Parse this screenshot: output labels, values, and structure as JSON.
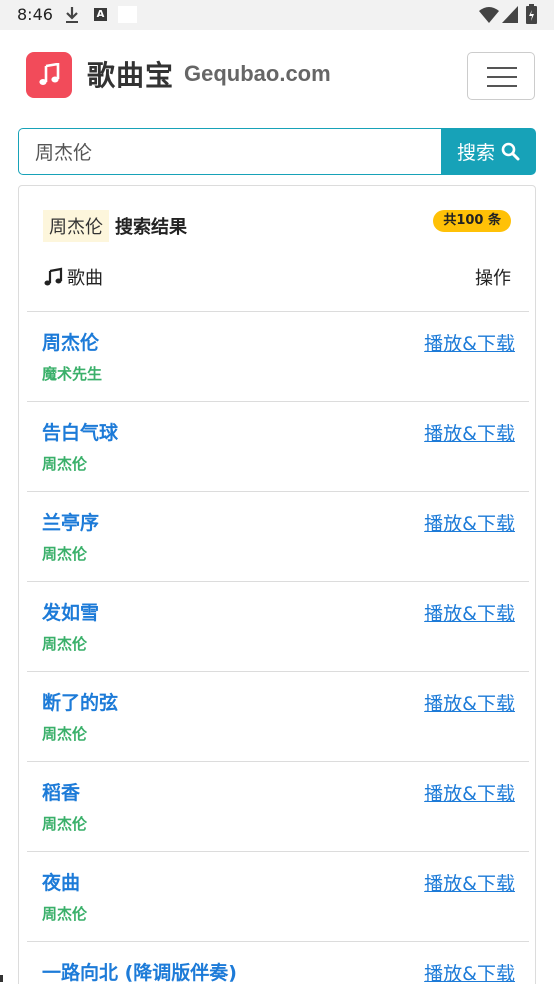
{
  "status_bar": {
    "time": "8:46",
    "icons": [
      "download-icon",
      "a-letter-icon",
      "white-box-icon",
      "wifi-icon",
      "signal-icon",
      "battery-icon"
    ],
    "a_letter": "A"
  },
  "navbar": {
    "brand_cn": "歌曲宝",
    "brand_en": "Gequbao.com",
    "logo_color": "#f24b5a",
    "menu_icon": "hamburger-icon"
  },
  "search": {
    "value": "周杰伦",
    "button_label": "搜索",
    "accent": "#17a2b8"
  },
  "results": {
    "query": "周杰伦",
    "label": "搜索结果",
    "count": "共100 条",
    "col_song": "歌曲",
    "col_op": "操作",
    "items": [
      {
        "title": "周杰伦",
        "artist": "魔术先生",
        "action": "播放&下载"
      },
      {
        "title": "告白气球",
        "artist": "周杰伦",
        "action": "播放&下载"
      },
      {
        "title": "兰亭序",
        "artist": "周杰伦",
        "action": "播放&下载"
      },
      {
        "title": "发如雪",
        "artist": "周杰伦",
        "action": "播放&下载"
      },
      {
        "title": "断了的弦",
        "artist": "周杰伦",
        "action": "播放&下载"
      },
      {
        "title": "稻香",
        "artist": "周杰伦",
        "action": "播放&下载"
      },
      {
        "title": "夜曲",
        "artist": "周杰伦",
        "action": "播放&下载"
      },
      {
        "title": "一路向北 (降调版伴奏)",
        "artist": "",
        "action": "播放&下载"
      }
    ]
  },
  "colors": {
    "link": "#1d7bd8",
    "artist": "#3ab06a",
    "badge": "#ffc107"
  }
}
